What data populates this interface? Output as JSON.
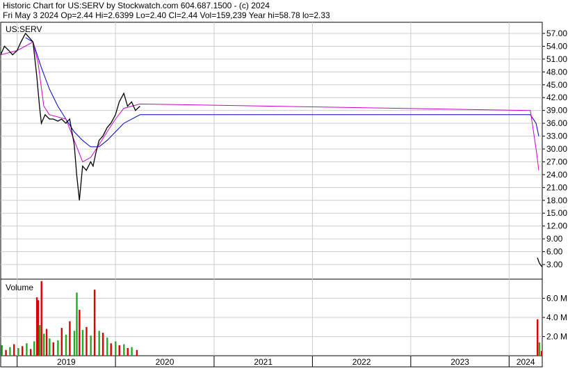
{
  "header": {
    "line1": "Historic Chart for US:SERV by Stockwatch.com 604.687.1500 - (c) 2024",
    "line2": "Fri May  3 2024   Op=2.44   Hi=2.6399   Lo=2.40   Cl=2.44   Vol=159,239   Year hi=58.78   lo=2.33"
  },
  "chart_data": {
    "type": "line",
    "symbol_label": "US:SERV",
    "volume_label": "Volume",
    "price_ticks": [
      "57.00",
      "54.00",
      "51.00",
      "48.00",
      "45.00",
      "42.00",
      "39.00",
      "36.00",
      "33.00",
      "30.00",
      "27.00",
      "24.00",
      "21.00",
      "18.00",
      "15.00",
      "12.00",
      "9.00",
      "6.00",
      "3.00"
    ],
    "volume_ticks": [
      "6.0 M",
      "4.0 M",
      "2.0 M"
    ],
    "years": [
      "2019",
      "2020",
      "2021",
      "2022",
      "2023",
      "2024"
    ],
    "ylim": [
      0,
      60
    ],
    "volume_max_m": 8,
    "colors": {
      "price": "#000000",
      "ma_short": "#cc00cc",
      "ma_long": "#0000cc",
      "vol_up": "#22aa22",
      "vol_down": "#dd0000",
      "grid": "#cccccc"
    },
    "price": [
      {
        "d": "2018-11-01",
        "c": 52
      },
      {
        "d": "2018-11-15",
        "c": 54
      },
      {
        "d": "2018-12-01",
        "c": 53
      },
      {
        "d": "2018-12-15",
        "c": 52
      },
      {
        "d": "2019-01-01",
        "c": 53
      },
      {
        "d": "2019-01-15",
        "c": 55
      },
      {
        "d": "2019-02-01",
        "c": 57
      },
      {
        "d": "2019-02-15",
        "c": 56
      },
      {
        "d": "2019-03-01",
        "c": 55
      },
      {
        "d": "2019-03-15",
        "c": 47
      },
      {
        "d": "2019-03-25",
        "c": 40
      },
      {
        "d": "2019-04-01",
        "c": 36
      },
      {
        "d": "2019-04-15",
        "c": 38
      },
      {
        "d": "2019-05-01",
        "c": 37
      },
      {
        "d": "2019-05-15",
        "c": 37
      },
      {
        "d": "2019-06-01",
        "c": 36.5
      },
      {
        "d": "2019-06-15",
        "c": 37
      },
      {
        "d": "2019-07-01",
        "c": 36
      },
      {
        "d": "2019-07-15",
        "c": 37
      },
      {
        "d": "2019-08-01",
        "c": 31
      },
      {
        "d": "2019-08-10",
        "c": 24
      },
      {
        "d": "2019-08-20",
        "c": 18
      },
      {
        "d": "2019-09-01",
        "c": 26
      },
      {
        "d": "2019-09-15",
        "c": 25
      },
      {
        "d": "2019-10-01",
        "c": 27
      },
      {
        "d": "2019-10-10",
        "c": 26
      },
      {
        "d": "2019-10-20",
        "c": 29
      },
      {
        "d": "2019-11-01",
        "c": 32
      },
      {
        "d": "2019-11-15",
        "c": 33
      },
      {
        "d": "2019-12-01",
        "c": 35
      },
      {
        "d": "2019-12-15",
        "c": 36
      },
      {
        "d": "2020-01-01",
        "c": 38
      },
      {
        "d": "2020-01-15",
        "c": 41
      },
      {
        "d": "2020-02-01",
        "c": 43
      },
      {
        "d": "2020-02-15",
        "c": 40
      },
      {
        "d": "2020-03-01",
        "c": 41
      },
      {
        "d": "2020-03-15",
        "c": 39
      },
      {
        "d": "2020-04-01",
        "c": 40
      }
    ],
    "price_tail": [
      {
        "d": "2024-04-15",
        "c": 4.6
      },
      {
        "d": "2024-04-22",
        "c": 3.4
      },
      {
        "d": "2024-04-28",
        "c": 2.8
      },
      {
        "d": "2024-05-03",
        "c": 2.44
      }
    ],
    "ma_short": [
      {
        "d": "2018-11-01",
        "c": 52
      },
      {
        "d": "2019-01-01",
        "c": 53
      },
      {
        "d": "2019-03-01",
        "c": 55
      },
      {
        "d": "2019-03-20",
        "c": 50
      },
      {
        "d": "2019-04-10",
        "c": 40
      },
      {
        "d": "2019-05-01",
        "c": 38
      },
      {
        "d": "2019-07-01",
        "c": 37
      },
      {
        "d": "2019-08-01",
        "c": 32
      },
      {
        "d": "2019-09-01",
        "c": 27
      },
      {
        "d": "2019-10-01",
        "c": 28
      },
      {
        "d": "2019-11-01",
        "c": 31
      },
      {
        "d": "2019-12-01",
        "c": 34
      },
      {
        "d": "2020-01-01",
        "c": 37
      },
      {
        "d": "2020-02-01",
        "c": 39.5
      },
      {
        "d": "2020-04-01",
        "c": 40.5
      },
      {
        "d": "2024-03-20",
        "c": 39
      },
      {
        "d": "2024-04-10",
        "c": 30
      },
      {
        "d": "2024-04-20",
        "c": 25
      }
    ],
    "ma_long": [
      {
        "d": "2019-02-01",
        "c": 56
      },
      {
        "d": "2019-03-01",
        "c": 55
      },
      {
        "d": "2019-04-01",
        "c": 49
      },
      {
        "d": "2019-05-01",
        "c": 44
      },
      {
        "d": "2019-06-01",
        "c": 40
      },
      {
        "d": "2019-07-01",
        "c": 37
      },
      {
        "d": "2019-08-01",
        "c": 34
      },
      {
        "d": "2019-09-01",
        "c": 32
      },
      {
        "d": "2019-10-01",
        "c": 30.5
      },
      {
        "d": "2019-11-01",
        "c": 30.5
      },
      {
        "d": "2019-12-01",
        "c": 32
      },
      {
        "d": "2020-01-01",
        "c": 34
      },
      {
        "d": "2020-02-01",
        "c": 36
      },
      {
        "d": "2020-04-01",
        "c": 38
      },
      {
        "d": "2024-03-20",
        "c": 38
      },
      {
        "d": "2024-04-10",
        "c": 36
      },
      {
        "d": "2024-04-20",
        "c": 33
      }
    ],
    "volume": [
      {
        "d": "2018-11-05",
        "v": 1.1,
        "up": true
      },
      {
        "d": "2018-11-20",
        "v": 0.6,
        "up": false
      },
      {
        "d": "2018-12-05",
        "v": 0.9,
        "up": true
      },
      {
        "d": "2018-12-20",
        "v": 1.2,
        "up": false
      },
      {
        "d": "2019-01-05",
        "v": 0.8,
        "up": true
      },
      {
        "d": "2019-01-20",
        "v": 1.0,
        "up": false
      },
      {
        "d": "2019-02-05",
        "v": 1.3,
        "up": true
      },
      {
        "d": "2019-02-20",
        "v": 0.7,
        "up": false
      },
      {
        "d": "2019-03-05",
        "v": 1.5,
        "up": true
      },
      {
        "d": "2019-03-15",
        "v": 6.1,
        "up": false
      },
      {
        "d": "2019-03-20",
        "v": 5.8,
        "up": false
      },
      {
        "d": "2019-03-25",
        "v": 3.2,
        "up": true
      },
      {
        "d": "2019-04-01",
        "v": 7.8,
        "up": false
      },
      {
        "d": "2019-04-10",
        "v": 2.3,
        "up": true
      },
      {
        "d": "2019-04-20",
        "v": 2.8,
        "up": false
      },
      {
        "d": "2019-05-01",
        "v": 1.8,
        "up": true
      },
      {
        "d": "2019-05-15",
        "v": 1.4,
        "up": false
      },
      {
        "d": "2019-06-01",
        "v": 1.6,
        "up": true
      },
      {
        "d": "2019-06-15",
        "v": 2.9,
        "up": false
      },
      {
        "d": "2019-07-01",
        "v": 2.2,
        "up": true
      },
      {
        "d": "2019-07-15",
        "v": 3.6,
        "up": false
      },
      {
        "d": "2019-08-01",
        "v": 2.6,
        "up": true
      },
      {
        "d": "2019-08-10",
        "v": 6.6,
        "up": true
      },
      {
        "d": "2019-08-20",
        "v": 4.8,
        "up": false
      },
      {
        "d": "2019-09-01",
        "v": 2.7,
        "up": true
      },
      {
        "d": "2019-09-15",
        "v": 3.0,
        "up": false
      },
      {
        "d": "2019-10-01",
        "v": 2.1,
        "up": true
      },
      {
        "d": "2019-10-15",
        "v": 6.9,
        "up": false
      },
      {
        "d": "2019-11-01",
        "v": 2.6,
        "up": true
      },
      {
        "d": "2019-11-15",
        "v": 2.4,
        "up": false
      },
      {
        "d": "2019-12-01",
        "v": 1.9,
        "up": true
      },
      {
        "d": "2019-12-15",
        "v": 1.3,
        "up": false
      },
      {
        "d": "2020-01-01",
        "v": 1.5,
        "up": true
      },
      {
        "d": "2020-01-15",
        "v": 1.1,
        "up": false
      },
      {
        "d": "2020-02-01",
        "v": 1.2,
        "up": true
      },
      {
        "d": "2020-02-15",
        "v": 0.8,
        "up": false
      },
      {
        "d": "2020-03-01",
        "v": 0.9,
        "up": true
      },
      {
        "d": "2020-03-20",
        "v": 0.6,
        "up": false
      },
      {
        "d": "2024-04-15",
        "v": 3.8,
        "up": false
      },
      {
        "d": "2024-04-22",
        "v": 1.4,
        "up": true
      },
      {
        "d": "2024-04-30",
        "v": 0.5,
        "up": false
      }
    ]
  }
}
